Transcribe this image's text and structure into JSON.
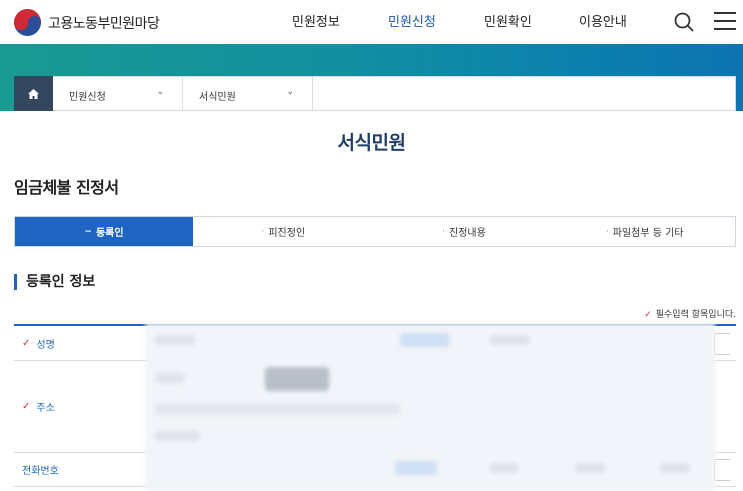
{
  "header": {
    "logo_text": "고용노동부민원마당",
    "nav": [
      {
        "label": "민원정보",
        "active": false
      },
      {
        "label": "민원신청",
        "active": true
      },
      {
        "label": "민원확인",
        "active": false
      },
      {
        "label": "이용안내",
        "active": false
      }
    ],
    "search_icon": "search-icon",
    "menu_icon": "hamburger-menu-icon"
  },
  "breadcrumb": {
    "home_icon": "home-icon",
    "items": [
      {
        "label": "민원신청"
      },
      {
        "label": "서식민원"
      }
    ]
  },
  "page_title": "서식민원",
  "form_title": "임금체불 진정서",
  "steps": [
    {
      "label": "등록인",
      "active": true
    },
    {
      "label": "피진정인",
      "active": false
    },
    {
      "label": "진정내용",
      "active": false
    },
    {
      "label": "파일첨부 등 기타",
      "active": false
    }
  ],
  "section": {
    "title": "등록인 정보",
    "required_note": "필수입력 항목입니다."
  },
  "form_rows": [
    {
      "label": "성명",
      "required": true
    },
    {
      "label": "주소",
      "required": true
    },
    {
      "label": "전화번호",
      "required": false
    }
  ],
  "colors": {
    "accent": "#1e64c0",
    "title": "#1f3f66",
    "required_mark": "#d12a2a",
    "banner_start": "#1a9a92",
    "banner_end": "#0d74b0"
  }
}
